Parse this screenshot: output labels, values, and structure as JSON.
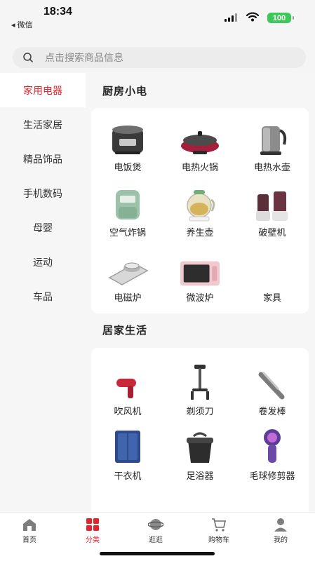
{
  "status_bar": {
    "time": "18:34",
    "back_label": "◂ 微信",
    "battery": "100"
  },
  "search": {
    "placeholder": "点击搜索商品信息"
  },
  "sidebar": {
    "items": [
      {
        "label": "家用电器",
        "active": true
      },
      {
        "label": "生活家居",
        "active": false
      },
      {
        "label": "精品饰品",
        "active": false
      },
      {
        "label": "手机数码",
        "active": false
      },
      {
        "label": "母婴",
        "active": false
      },
      {
        "label": "运动",
        "active": false
      },
      {
        "label": "车品",
        "active": false
      }
    ]
  },
  "sections": [
    {
      "title": "厨房小电",
      "products": [
        {
          "name": "电饭煲",
          "icon": "rice-cooker-icon"
        },
        {
          "name": "电热火锅",
          "icon": "hot-pot-icon"
        },
        {
          "name": "电热水壶",
          "icon": "kettle-icon"
        },
        {
          "name": "空气炸锅",
          "icon": "air-fryer-icon"
        },
        {
          "name": "养生壶",
          "icon": "health-pot-icon"
        },
        {
          "name": "破壁机",
          "icon": "blender-icon"
        },
        {
          "name": "电磁炉",
          "icon": "induction-cooker-icon"
        },
        {
          "name": "微波炉",
          "icon": "microwave-icon"
        },
        {
          "name": "家具",
          "icon": ""
        }
      ]
    },
    {
      "title": "居家生活",
      "products": [
        {
          "name": "吹风机",
          "icon": "hair-dryer-icon"
        },
        {
          "name": "剃须刀",
          "icon": "razor-icon"
        },
        {
          "name": "卷发棒",
          "icon": "curling-iron-icon"
        },
        {
          "name": "干衣机",
          "icon": "clothes-dryer-icon"
        },
        {
          "name": "足浴器",
          "icon": "foot-bath-icon"
        },
        {
          "name": "毛球修剪器",
          "icon": "lint-remover-icon"
        }
      ]
    }
  ],
  "tab_bar": {
    "tabs": [
      {
        "label": "首页",
        "icon": "home-icon",
        "active": false
      },
      {
        "label": "分类",
        "icon": "category-icon",
        "active": true
      },
      {
        "label": "逛逛",
        "icon": "explore-icon",
        "active": false
      },
      {
        "label": "购物车",
        "icon": "cart-icon",
        "active": false
      },
      {
        "label": "我的",
        "icon": "profile-icon",
        "active": false
      }
    ]
  },
  "colors": {
    "accent": "#e6232b",
    "battery": "#3ec85a",
    "background": "#f6f6f6"
  }
}
